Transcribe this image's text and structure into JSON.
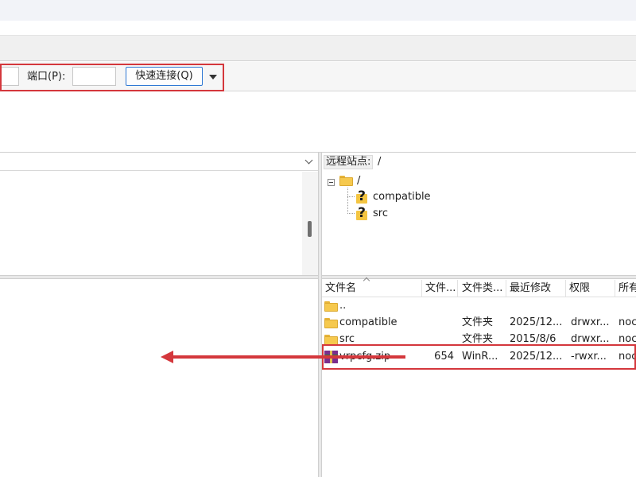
{
  "quickconnect": {
    "port_label": "端口(P):",
    "port_value": "",
    "connect_button": "快速连接(Q)"
  },
  "local": {
    "path_value": ""
  },
  "remote": {
    "path_label": "远程站点:",
    "path_value": "/",
    "tree": [
      {
        "label": "/",
        "icon": "folder-icon",
        "expanded": true
      },
      {
        "label": "compatible",
        "icon": "question-folder-icon"
      },
      {
        "label": "src",
        "icon": "question-folder-icon"
      }
    ],
    "columns": [
      "文件名",
      "文件...",
      "文件类...",
      "最近修改",
      "权限",
      "所有"
    ],
    "files": [
      {
        "name": "..",
        "size": "",
        "type": "",
        "modified": "",
        "perms": "",
        "owner": "",
        "icon": "folder-icon"
      },
      {
        "name": "compatible",
        "size": "",
        "type": "文件夹",
        "modified": "2025/12...",
        "perms": "drwxr...",
        "owner": "noc",
        "icon": "folder-icon"
      },
      {
        "name": "src",
        "size": "",
        "type": "文件夹",
        "modified": "2015/8/6",
        "perms": "drwxr...",
        "owner": "noc",
        "icon": "folder-icon"
      },
      {
        "name": "vrpcfg.zip",
        "size": "654",
        "type": "WinR...",
        "modified": "2025/12...",
        "perms": "-rwxr...",
        "owner": "noc",
        "icon": "winrar-archive-icon"
      }
    ]
  },
  "annotation": {
    "color": "#d4373c",
    "arrow_direction": "left"
  }
}
